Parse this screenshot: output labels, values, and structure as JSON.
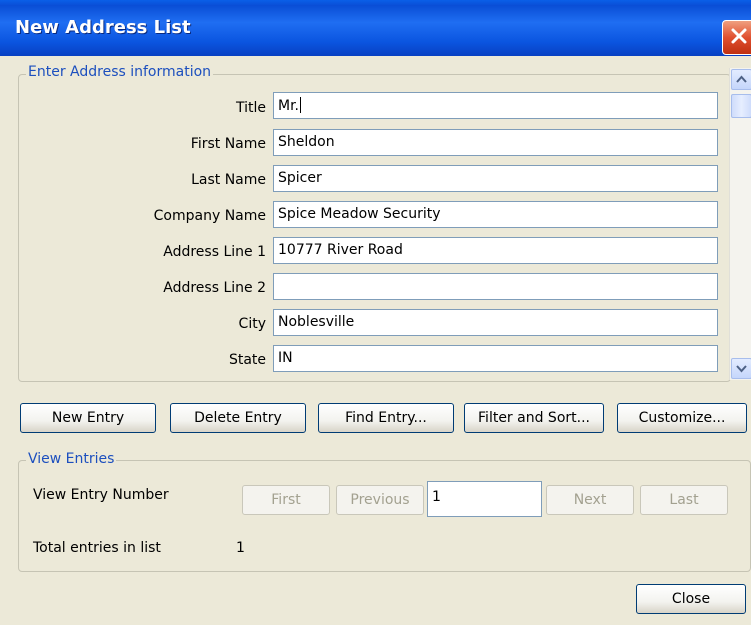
{
  "window": {
    "title": "New Address List"
  },
  "address_group": {
    "label": "Enter Address information",
    "fields": [
      {
        "label": "Title",
        "value": "Mr."
      },
      {
        "label": "First Name",
        "value": "Sheldon"
      },
      {
        "label": "Last Name",
        "value": "Spicer"
      },
      {
        "label": "Company Name",
        "value": "Spice Meadow Security"
      },
      {
        "label": "Address Line 1",
        "value": "10777 River Road"
      },
      {
        "label": "Address Line 2",
        "value": ""
      },
      {
        "label": "City",
        "value": "Noblesville"
      },
      {
        "label": "State",
        "value": "IN"
      }
    ]
  },
  "actions": {
    "new_entry": "New Entry",
    "delete_entry": "Delete Entry",
    "find_entry": "Find Entry...",
    "filter_sort": "Filter and Sort...",
    "customize": "Customize..."
  },
  "view_group": {
    "label": "View Entries",
    "entry_number_label": "View Entry Number",
    "first": "First",
    "previous": "Previous",
    "entry_number": "1",
    "next": "Next",
    "last": "Last",
    "total_label": "Total entries in list",
    "total_value": "1"
  },
  "footer": {
    "close": "Close"
  },
  "colors": {
    "titlebar": "#0a4ed6",
    "group_label": "#1c4fbe",
    "dialog_bg": "#ece9d8"
  },
  "icons": [
    "close-icon",
    "scroll-up-icon",
    "scroll-down-icon"
  ]
}
